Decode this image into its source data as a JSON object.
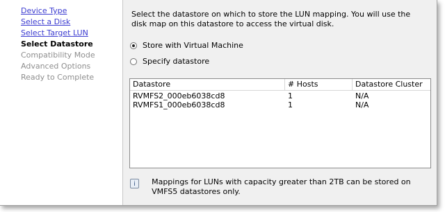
{
  "nav": {
    "steps": [
      {
        "label": "Device Type",
        "state": "link"
      },
      {
        "label": "Select a Disk",
        "state": "link"
      },
      {
        "label": "Select Target LUN",
        "state": "link"
      },
      {
        "label": "Select Datastore",
        "state": "current"
      },
      {
        "label": "Compatibility Mode",
        "state": "disabled"
      },
      {
        "label": "Advanced Options",
        "state": "disabled"
      },
      {
        "label": "Ready to Complete",
        "state": "disabled"
      }
    ]
  },
  "main": {
    "instructions": "Select the datastore on which to store the LUN mapping. You will use the disk map on this datastore to access the virtual disk.",
    "options": [
      {
        "label": "Store with Virtual Machine",
        "selected": true
      },
      {
        "label": "Specify datastore",
        "selected": false
      }
    ],
    "table": {
      "columns": [
        "Datastore",
        "# Hosts",
        "Datastore Cluster"
      ],
      "rows": [
        [
          "RVMFS2_000eb6038cd8",
          "1",
          "N/A"
        ],
        [
          "RVMFS1_000eb6038cd8",
          "1",
          "N/A"
        ]
      ]
    },
    "note": {
      "icon": "info-icon",
      "text": "Mappings for LUNs with capacity greater than 2TB can be stored on VMFS5 datastores only."
    }
  }
}
